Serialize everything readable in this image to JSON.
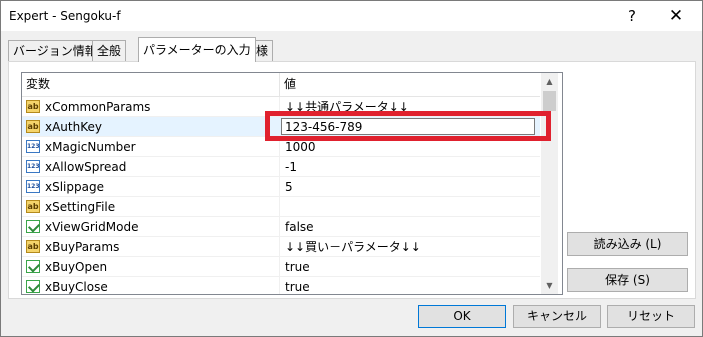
{
  "window": {
    "title": "Expert - Sengoku-f",
    "help_label": "?",
    "close_label": "✕"
  },
  "tabs": [
    {
      "label": "バージョン情報"
    },
    {
      "label": "全般"
    },
    {
      "label": "パラメーターの入力"
    },
    {
      "label": "仕様"
    }
  ],
  "grid": {
    "headers": {
      "variable": "変数",
      "value": "値"
    },
    "rows": [
      {
        "icon": "ab-string-icon",
        "name": "xCommonParams",
        "value": "↓↓共通パラメータ↓↓"
      },
      {
        "icon": "ab-string-icon",
        "name": "xAuthKey",
        "value": "123-456-789"
      },
      {
        "icon": "123-number-icon",
        "name": "xMagicNumber",
        "value": "1000"
      },
      {
        "icon": "123-number-icon",
        "name": "xAllowSpread",
        "value": "-1"
      },
      {
        "icon": "123-number-icon",
        "name": "xSlippage",
        "value": "5"
      },
      {
        "icon": "ab-string-icon",
        "name": "xSettingFile",
        "value": ""
      },
      {
        "icon": "bool-icon",
        "name": "xViewGridMode",
        "value": "false"
      },
      {
        "icon": "ab-string-icon",
        "name": "xBuyParams",
        "value": "↓↓買い－パラメータ↓↓"
      },
      {
        "icon": "bool-icon",
        "name": "xBuyOpen",
        "value": "true"
      },
      {
        "icon": "bool-icon",
        "name": "xBuyClose",
        "value": "true"
      }
    ]
  },
  "side_buttons": {
    "load": "読み込み (L)",
    "save": "保存 (S)"
  },
  "footer_buttons": {
    "ok": "OK",
    "cancel": "キャンセル",
    "reset": "リセット"
  },
  "colors": {
    "highlight": "#e0212e",
    "selected_row": "#e5f3ff"
  }
}
